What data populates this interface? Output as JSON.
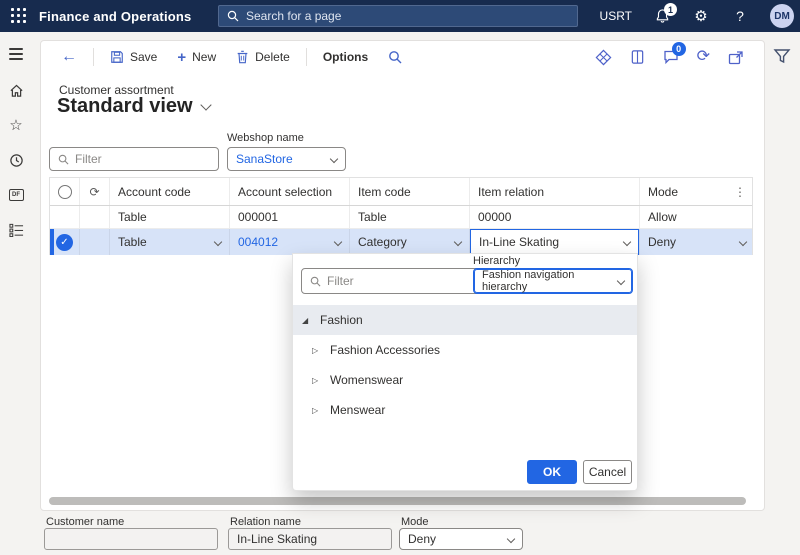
{
  "topbar": {
    "app_title": "Finance and Operations",
    "search_placeholder": "Search for a page",
    "environment": "USRT",
    "notifications_badge": "1",
    "avatar_initials": "DM"
  },
  "toolbar": {
    "save_label": "Save",
    "new_label": "New",
    "delete_label": "Delete",
    "options_label": "Options",
    "messages_badge": "0"
  },
  "page": {
    "caption": "Customer assortment",
    "view_title": "Standard view"
  },
  "filter_bar": {
    "filter_placeholder": "Filter",
    "webshop_label": "Webshop name",
    "webshop_value": "SanaStore"
  },
  "grid": {
    "columns": [
      "Account code",
      "Account selection",
      "Item code",
      "Item relation",
      "Mode"
    ],
    "rows": [
      {
        "account_code": "Table",
        "account_selection": "000001",
        "item_code": "Table",
        "item_relation": "00000",
        "mode": "Allow",
        "selected": false
      },
      {
        "account_code": "Table",
        "account_selection": "004012",
        "item_code": "Category",
        "item_relation": "In-Line Skating",
        "mode": "Deny",
        "selected": true
      }
    ]
  },
  "flyout": {
    "filter_placeholder": "Filter",
    "hierarchy_label": "Hierarchy",
    "hierarchy_value": "Fashion navigation hierarchy",
    "tree": [
      {
        "label": "Fashion",
        "level": 0,
        "expanded": true,
        "selected": true
      },
      {
        "label": "Fashion Accessories",
        "level": 1,
        "expanded": false,
        "selected": false
      },
      {
        "label": "Womenswear",
        "level": 1,
        "expanded": false,
        "selected": false
      },
      {
        "label": "Menswear",
        "level": 1,
        "expanded": false,
        "selected": false
      }
    ],
    "ok_label": "OK",
    "cancel_label": "Cancel"
  },
  "footer": {
    "customer_name_label": "Customer name",
    "customer_name_value": "",
    "relation_name_label": "Relation name",
    "relation_name_value": "In-Line Skating",
    "mode_label": "Mode",
    "mode_value": "Deny"
  },
  "icons": {
    "back_arrow": "←",
    "plus": "+",
    "star": "☆",
    "gear": "⚙",
    "help": "?",
    "refresh": "⟳",
    "grid_refresh": "⟳",
    "more_vertical": "⋮",
    "check": "✓",
    "tree_expanded": "◢",
    "tree_collapsed": "▷"
  },
  "colors": {
    "topbar_bg": "#172b4e",
    "accent_blue": "#2266e3",
    "selected_row_bg": "#d7e3f8",
    "toolbar_icon_blue": "#4565c8"
  }
}
